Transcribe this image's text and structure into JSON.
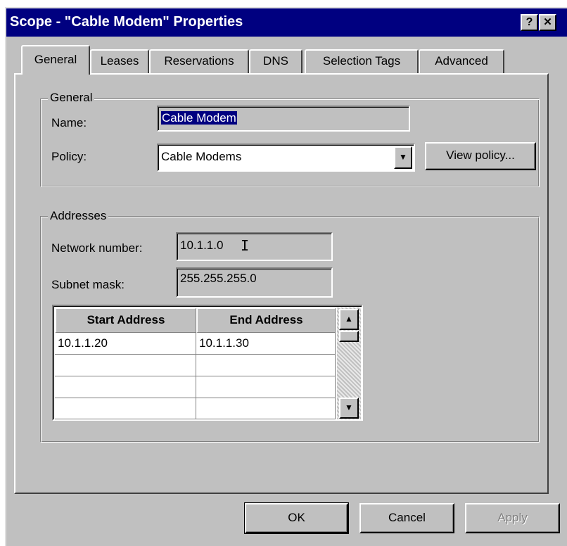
{
  "window": {
    "title": "Scope - \"Cable Modem\" Properties",
    "help_button": "?",
    "close_button": "✕"
  },
  "tabs": [
    {
      "label": "General",
      "active": true
    },
    {
      "label": "Leases"
    },
    {
      "label": "Reservations"
    },
    {
      "label": "DNS"
    },
    {
      "label": "Selection Tags"
    },
    {
      "label": "Advanced"
    }
  ],
  "general_group": {
    "legend": "General",
    "name_label": "Name:",
    "name_value": "Cable Modem",
    "policy_label": "Policy:",
    "policy_value": "Cable Modems",
    "view_policy_button": "View policy..."
  },
  "addresses_group": {
    "legend": "Addresses",
    "network_label": "Network number:",
    "network_value": "10.1.1.0",
    "subnet_label": "Subnet mask:",
    "subnet_value": "255.255.255.0",
    "columns": [
      "Start Address",
      "End Address"
    ],
    "rows": [
      [
        "10.1.1.20",
        "10.1.1.30"
      ],
      [
        "",
        ""
      ],
      [
        "",
        ""
      ],
      [
        "",
        ""
      ]
    ]
  },
  "footer": {
    "ok": "OK",
    "cancel": "Cancel",
    "apply": "Apply"
  },
  "colors": {
    "titlebar": "#000080",
    "dialog_face": "#c0c0c0",
    "selection": "#000080"
  }
}
